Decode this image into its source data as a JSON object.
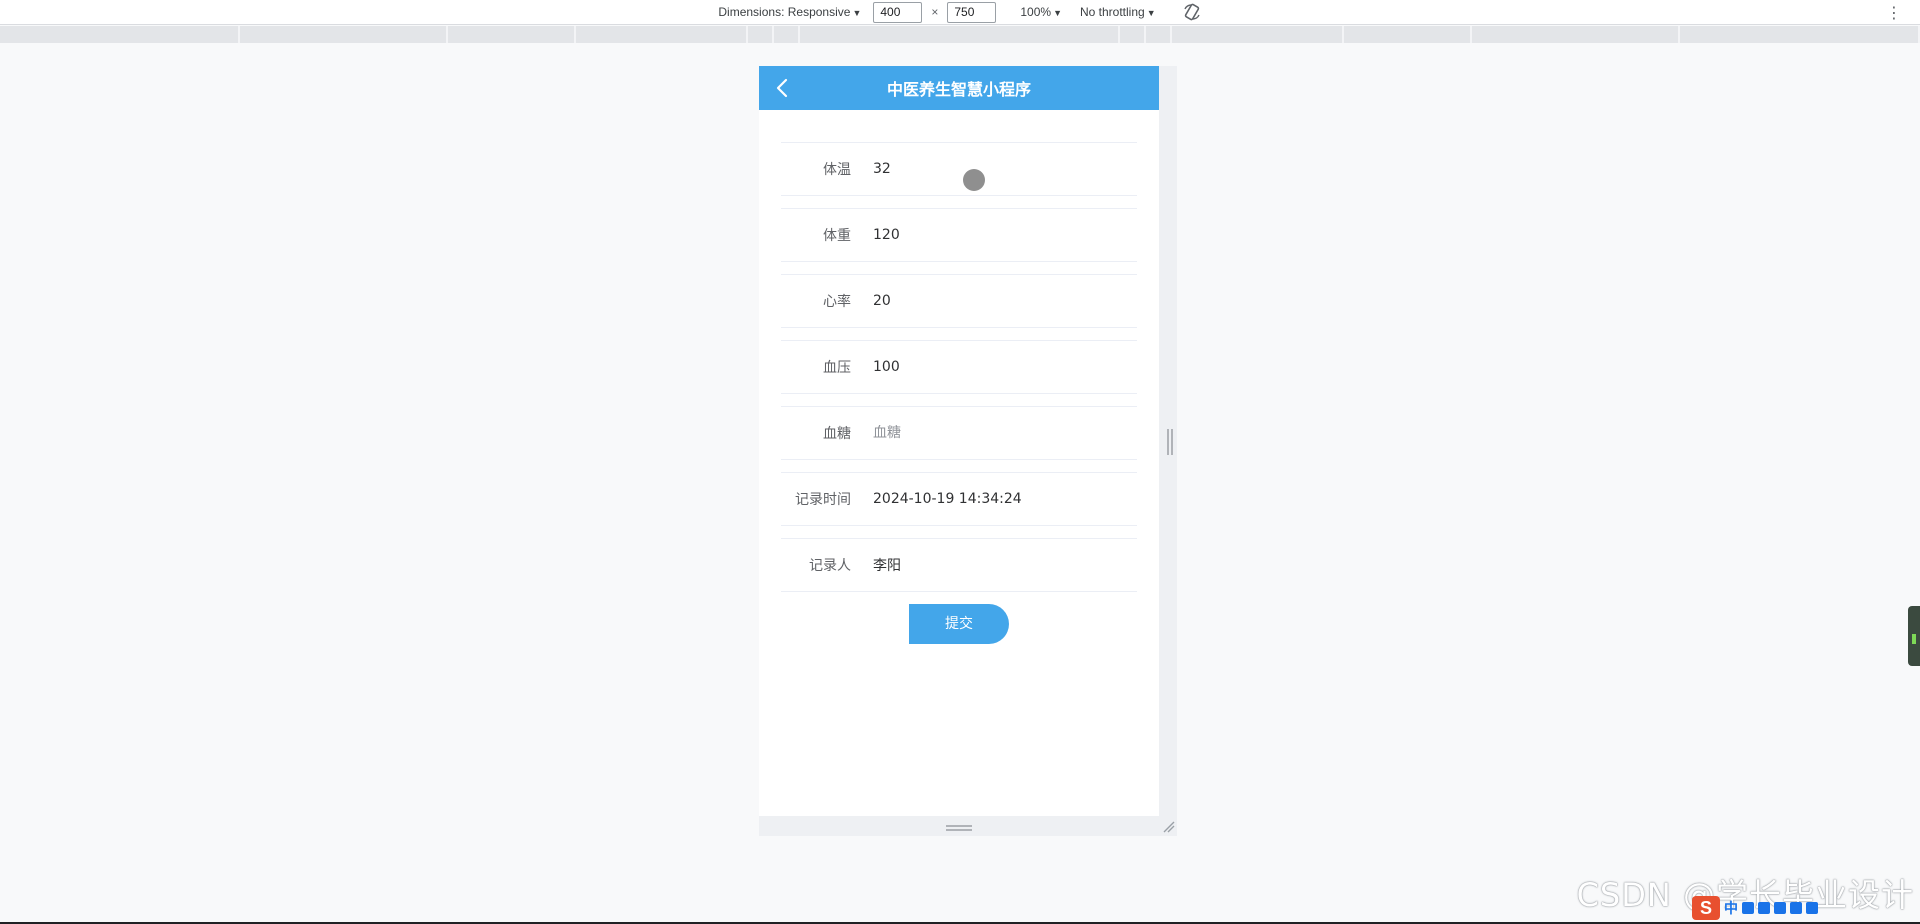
{
  "devtools": {
    "dimensions_label": "Dimensions: Responsive",
    "width_value": "400",
    "times": "×",
    "height_value": "750",
    "zoom_label": "100%",
    "throttling_label": "No throttling"
  },
  "app": {
    "title": "中医养生智慧小程序",
    "accent_color": "#43a6ea"
  },
  "form": {
    "fields": [
      {
        "label": "体温",
        "value": "32",
        "placeholder": ""
      },
      {
        "label": "体重",
        "value": "120",
        "placeholder": ""
      },
      {
        "label": "心率",
        "value": "20",
        "placeholder": ""
      },
      {
        "label": "血压",
        "value": "100",
        "placeholder": ""
      },
      {
        "label": "血糖",
        "value": "",
        "placeholder": "血糖"
      },
      {
        "label": "记录时间",
        "value": "2024-10-19 14:34:24",
        "placeholder": ""
      },
      {
        "label": "记录人",
        "value": "李阳",
        "placeholder": ""
      }
    ],
    "submit_label": "提交"
  },
  "overlay": {
    "watermark": "CSDN @学长毕业设计",
    "ime_label": "S",
    "ime_lang": "中"
  }
}
